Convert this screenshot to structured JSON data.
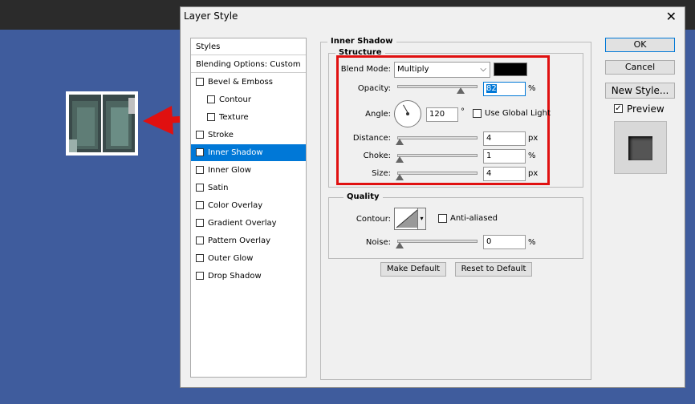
{
  "dialog": {
    "title": "Layer Style",
    "close_glyph": "✕"
  },
  "styles_list": {
    "header": "Styles",
    "blending_options": "Blending Options: Custom",
    "items": [
      {
        "label": "Bevel & Emboss",
        "checked": false
      },
      {
        "label": "Contour",
        "checked": false
      },
      {
        "label": "Texture",
        "checked": false
      },
      {
        "label": "Stroke",
        "checked": false
      },
      {
        "label": "Inner Shadow",
        "checked": true
      },
      {
        "label": "Inner Glow",
        "checked": false
      },
      {
        "label": "Satin",
        "checked": false
      },
      {
        "label": "Color Overlay",
        "checked": false
      },
      {
        "label": "Gradient Overlay",
        "checked": false
      },
      {
        "label": "Pattern Overlay",
        "checked": false
      },
      {
        "label": "Outer Glow",
        "checked": false
      },
      {
        "label": "Drop Shadow",
        "checked": false
      }
    ],
    "selected": "Inner Shadow"
  },
  "inner_shadow": {
    "group_title": "Inner Shadow",
    "structure_title": "Structure",
    "blend_mode_label": "Blend Mode:",
    "blend_mode_value": "Multiply",
    "shadow_color": "#000000",
    "opacity_label": "Opacity:",
    "opacity_value": "82",
    "opacity_unit": "%",
    "angle_label": "Angle:",
    "angle_value": "120",
    "angle_unit": "°",
    "use_global_light_label": "Use Global Light",
    "use_global_light": false,
    "distance_label": "Distance:",
    "distance_value": "4",
    "distance_unit": "px",
    "choke_label": "Choke:",
    "choke_value": "1",
    "choke_unit": "%",
    "size_label": "Size:",
    "size_value": "4",
    "size_unit": "px"
  },
  "quality": {
    "title": "Quality",
    "contour_label": "Contour:",
    "anti_aliased_label": "Anti-aliased",
    "anti_aliased": false,
    "noise_label": "Noise:",
    "noise_value": "0",
    "noise_unit": "%"
  },
  "bottom_buttons": {
    "make_default": "Make Default",
    "reset_to_default": "Reset to Default"
  },
  "right_buttons": {
    "ok": "OK",
    "cancel": "Cancel",
    "new_style": "New Style...",
    "preview_label": "Preview",
    "preview_checked": true
  },
  "colors": {
    "background": "#3f5c9d",
    "selection": "#0078d7",
    "highlight_box": "#e01010",
    "arrow": "#e01010"
  }
}
